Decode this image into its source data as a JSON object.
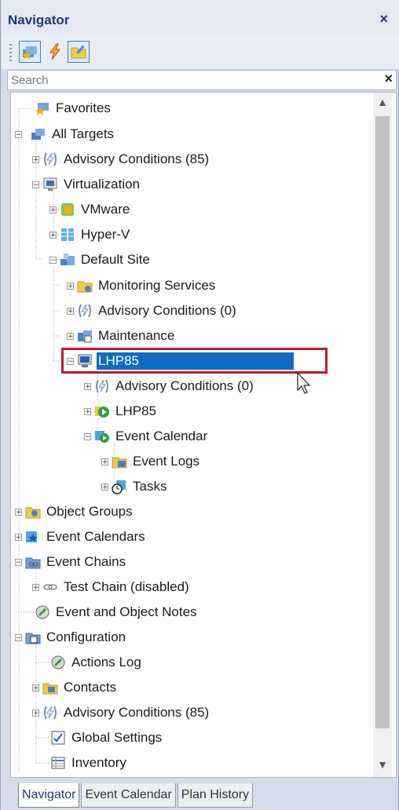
{
  "panel": {
    "title": "Navigator",
    "close_glyph": "×"
  },
  "toolbar": {
    "buttons": [
      {
        "icon": "targets-star-icon",
        "pressed": true
      },
      {
        "icon": "lightning-icon",
        "pressed": false
      },
      {
        "icon": "folder-edit-icon",
        "pressed": true
      }
    ]
  },
  "search": {
    "placeholder": "Search",
    "clear_glyph": "×"
  },
  "tree": {
    "nodes": [
      {
        "label": "Favorites",
        "icon": "favorites-icon"
      },
      {
        "label": "All Targets",
        "icon": "all-targets-icon"
      },
      {
        "label": "Advisory Conditions (85)",
        "icon": "advisory-icon"
      },
      {
        "label": "Virtualization",
        "icon": "virtualization-icon"
      },
      {
        "label": "VMware",
        "icon": "vmware-icon"
      },
      {
        "label": "Hyper-V",
        "icon": "hyperv-icon"
      },
      {
        "label": "Default Site",
        "icon": "site-icon"
      },
      {
        "label": "Monitoring Services",
        "icon": "monitoring-services-icon"
      },
      {
        "label": "Advisory Conditions (0)",
        "icon": "advisory-icon"
      },
      {
        "label": "Maintenance",
        "icon": "maintenance-icon"
      },
      {
        "label": "LHP85",
        "icon": "computer-icon",
        "selected": true
      },
      {
        "label": "Advisory Conditions (0)",
        "icon": "advisory-icon"
      },
      {
        "label": "LHP85",
        "icon": "play-circle-icon"
      },
      {
        "label": "Event Calendar",
        "icon": "event-calendar-icon"
      },
      {
        "label": "Event Logs",
        "icon": "event-logs-icon"
      },
      {
        "label": "Tasks",
        "icon": "tasks-icon"
      },
      {
        "label": "Object Groups",
        "icon": "object-groups-icon"
      },
      {
        "label": "Event Calendars",
        "icon": "event-calendars-icon"
      },
      {
        "label": "Event Chains",
        "icon": "event-chains-icon"
      },
      {
        "label": "Test Chain (disabled)",
        "icon": "chain-link-icon"
      },
      {
        "label": "Event and Object Notes",
        "icon": "notes-icon"
      },
      {
        "label": "Configuration",
        "icon": "configuration-icon"
      },
      {
        "label": "Actions Log",
        "icon": "actions-log-icon"
      },
      {
        "label": "Contacts",
        "icon": "contacts-icon"
      },
      {
        "label": "Advisory Conditions (85)",
        "icon": "advisory-icon"
      },
      {
        "label": "Global Settings",
        "icon": "global-settings-icon"
      },
      {
        "label": "Inventory",
        "icon": "inventory-icon"
      }
    ]
  },
  "tabs": [
    {
      "label": "Navigator",
      "active": true
    },
    {
      "label": "Event Calendar",
      "active": false
    },
    {
      "label": "Plan History",
      "active": false
    }
  ],
  "colors": {
    "selection": "#0f6cc0",
    "highlight_box": "#c21838",
    "title_text": "#1e3a6b"
  }
}
